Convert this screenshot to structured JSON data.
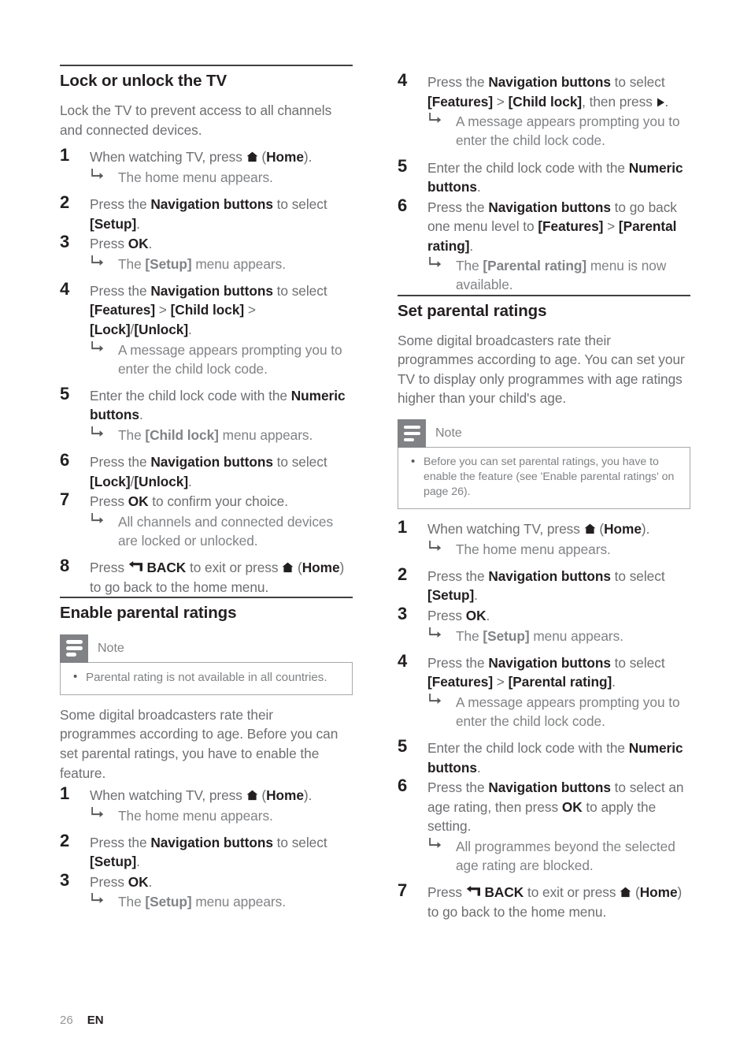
{
  "page": {
    "number": "26",
    "language": "EN"
  },
  "icons": {
    "home": "home-icon",
    "back": "back-arrow-icon",
    "right": "right-triangle-icon",
    "substep": "substep-arrow-icon",
    "note": "note-lines-icon"
  },
  "left_column": {
    "sections": [
      {
        "heading": "Lock or unlock the TV",
        "intro": "Lock the TV to prevent access to all channels and connected devices.",
        "steps": [
          {
            "num": "1",
            "parts": [
              {
                "t": "When watching TV, press "
              },
              {
                "icon": "home"
              },
              {
                "t": " ("
              },
              {
                "t": "Home",
                "b": true
              },
              {
                "t": ")."
              }
            ],
            "subs": [
              "The home menu appears."
            ]
          },
          {
            "num": "2",
            "parts": [
              {
                "t": "Press the "
              },
              {
                "t": "Navigation buttons",
                "b": true
              },
              {
                "t": " to select "
              },
              {
                "t": "[Setup]",
                "b": true
              },
              {
                "t": "."
              }
            ],
            "subs": []
          },
          {
            "num": "3",
            "tight": true,
            "parts": [
              {
                "t": "Press "
              },
              {
                "t": "OK",
                "b": true
              },
              {
                "t": "."
              }
            ],
            "subs_rich": [
              [
                {
                  "t": "The "
                },
                {
                  "t": "[Setup]",
                  "b": true
                },
                {
                  "t": " menu appears."
                }
              ]
            ]
          },
          {
            "num": "4",
            "parts": [
              {
                "t": "Press the "
              },
              {
                "t": "Navigation buttons",
                "b": true
              },
              {
                "t": " to select "
              },
              {
                "t": "[Features]",
                "b": true
              },
              {
                "t": " > "
              },
              {
                "t": "[Child lock]",
                "b": true
              },
              {
                "t": " > "
              },
              {
                "t": "[Lock]",
                "b": true
              },
              {
                "t": "/"
              },
              {
                "t": "[Unlock]",
                "b": true
              },
              {
                "t": "."
              }
            ],
            "subs": [
              "A message appears prompting you to enter the child lock code."
            ]
          },
          {
            "num": "5",
            "parts": [
              {
                "t": "Enter the child lock code with the "
              },
              {
                "t": "Numeric buttons",
                "b": true
              },
              {
                "t": "."
              }
            ],
            "subs_rich": [
              [
                {
                  "t": "The "
                },
                {
                  "t": "[Child lock]",
                  "b": true
                },
                {
                  "t": " menu appears."
                }
              ]
            ]
          },
          {
            "num": "6",
            "parts": [
              {
                "t": "Press the "
              },
              {
                "t": "Navigation buttons",
                "b": true
              },
              {
                "t": " to select "
              },
              {
                "t": "[Lock]",
                "b": true
              },
              {
                "t": "/"
              },
              {
                "t": "[Unlock]",
                "b": true
              },
              {
                "t": "."
              }
            ],
            "subs": []
          },
          {
            "num": "7",
            "tight": true,
            "parts": [
              {
                "t": "Press "
              },
              {
                "t": "OK",
                "b": true
              },
              {
                "t": " to confirm your choice."
              }
            ],
            "subs": [
              "All channels and connected devices are locked or unlocked."
            ]
          },
          {
            "num": "8",
            "parts": [
              {
                "t": "Press "
              },
              {
                "icon": "back"
              },
              {
                "t": " "
              },
              {
                "t": "BACK",
                "b": true
              },
              {
                "t": " to exit or press "
              },
              {
                "icon": "home"
              },
              {
                "t": " ("
              },
              {
                "t": "Home",
                "b": true
              },
              {
                "t": ") to go back to the home menu."
              }
            ],
            "subs": []
          }
        ]
      },
      {
        "heading": "Enable parental ratings",
        "note": {
          "label": "Note",
          "items": [
            "Parental rating is not available in all countries."
          ]
        },
        "intro": "Some digital broadcasters rate their programmes according to age. Before you can set parental ratings, you have to enable the feature.",
        "steps": [
          {
            "num": "1",
            "tight": true,
            "parts": [
              {
                "t": "When watching TV, press "
              },
              {
                "icon": "home"
              },
              {
                "t": " ("
              },
              {
                "t": "Home",
                "b": true
              },
              {
                "t": ")."
              }
            ],
            "subs": [
              "The home menu appears."
            ]
          },
          {
            "num": "2",
            "parts": [
              {
                "t": "Press the "
              },
              {
                "t": "Navigation buttons",
                "b": true
              },
              {
                "t": " to select "
              },
              {
                "t": "[Setup]",
                "b": true
              },
              {
                "t": "."
              }
            ],
            "subs": []
          },
          {
            "num": "3",
            "tight": true,
            "parts": [
              {
                "t": "Press "
              },
              {
                "t": "OK",
                "b": true
              },
              {
                "t": "."
              }
            ],
            "subs_rich": [
              [
                {
                  "t": "The "
                },
                {
                  "t": "[Setup]",
                  "b": true
                },
                {
                  "t": " menu appears."
                }
              ]
            ]
          }
        ]
      }
    ]
  },
  "right_column": {
    "sections": [
      {
        "heading": null,
        "steps": [
          {
            "num": "4",
            "parts": [
              {
                "t": "Press the "
              },
              {
                "t": "Navigation buttons",
                "b": true
              },
              {
                "t": " to select "
              },
              {
                "t": "[Features]",
                "b": true
              },
              {
                "t": " > "
              },
              {
                "t": "[Child lock]",
                "b": true
              },
              {
                "t": ", then press "
              },
              {
                "icon": "right"
              },
              {
                "t": "."
              }
            ],
            "subs": [
              "A message appears prompting you to enter the child lock code."
            ]
          },
          {
            "num": "5",
            "parts": [
              {
                "t": "Enter the child lock code with the "
              },
              {
                "t": "Numeric buttons",
                "b": true
              },
              {
                "t": "."
              }
            ],
            "subs": []
          },
          {
            "num": "6",
            "tight": true,
            "parts": [
              {
                "t": "Press the "
              },
              {
                "t": "Navigation buttons",
                "b": true
              },
              {
                "t": " to go back one menu level to "
              },
              {
                "t": "[Features]",
                "b": true
              },
              {
                "t": " > "
              },
              {
                "t": "[Parental rating]",
                "b": true
              },
              {
                "t": "."
              }
            ],
            "subs_rich": [
              [
                {
                  "t": "The "
                },
                {
                  "t": "[Parental rating]",
                  "b": true
                },
                {
                  "t": " menu is now available."
                }
              ]
            ]
          }
        ]
      },
      {
        "heading": "Set parental ratings",
        "intro": "Some digital broadcasters rate their programmes according to age. You can set your TV to display only programmes with age ratings higher than your child's age.",
        "note": {
          "label": "Note",
          "items": [
            "Before you can set parental ratings, you have to enable the feature (see 'Enable parental ratings' on page 26)."
          ]
        },
        "steps": [
          {
            "num": "1",
            "tight": true,
            "parts": [
              {
                "t": "When watching TV, press "
              },
              {
                "icon": "home"
              },
              {
                "t": " ("
              },
              {
                "t": "Home",
                "b": true
              },
              {
                "t": ")."
              }
            ],
            "subs": [
              "The home menu appears."
            ]
          },
          {
            "num": "2",
            "parts": [
              {
                "t": "Press the "
              },
              {
                "t": "Navigation buttons",
                "b": true
              },
              {
                "t": " to select "
              },
              {
                "t": "[Setup]",
                "b": true
              },
              {
                "t": "."
              }
            ],
            "subs": []
          },
          {
            "num": "3",
            "tight": true,
            "parts": [
              {
                "t": "Press "
              },
              {
                "t": "OK",
                "b": true
              },
              {
                "t": "."
              }
            ],
            "subs_rich": [
              [
                {
                  "t": "The "
                },
                {
                  "t": "[Setup]",
                  "b": true
                },
                {
                  "t": " menu appears."
                }
              ]
            ]
          },
          {
            "num": "4",
            "parts": [
              {
                "t": "Press the "
              },
              {
                "t": "Navigation buttons",
                "b": true
              },
              {
                "t": " to select "
              },
              {
                "t": "[Features]",
                "b": true
              },
              {
                "t": " > "
              },
              {
                "t": "[Parental rating]",
                "b": true
              },
              {
                "t": "."
              }
            ],
            "subs": [
              "A message appears prompting you to enter the child lock code."
            ]
          },
          {
            "num": "5",
            "parts": [
              {
                "t": "Enter the child lock code with the "
              },
              {
                "t": "Numeric buttons",
                "b": true
              },
              {
                "t": "."
              }
            ],
            "subs": []
          },
          {
            "num": "6",
            "tight": true,
            "parts": [
              {
                "t": "Press the "
              },
              {
                "t": "Navigation buttons",
                "b": true
              },
              {
                "t": " to select an age rating, then press "
              },
              {
                "t": "OK",
                "b": true
              },
              {
                "t": " to apply the setting."
              }
            ],
            "subs": [
              "All programmes beyond the selected age rating are blocked."
            ]
          },
          {
            "num": "7",
            "parts": [
              {
                "t": "Press "
              },
              {
                "icon": "back"
              },
              {
                "t": " "
              },
              {
                "t": "BACK",
                "b": true
              },
              {
                "t": " to exit or press "
              },
              {
                "icon": "home"
              },
              {
                "t": " ("
              },
              {
                "t": "Home",
                "b": true
              },
              {
                "t": ") to go back to the home menu."
              }
            ],
            "subs": []
          }
        ]
      }
    ]
  }
}
